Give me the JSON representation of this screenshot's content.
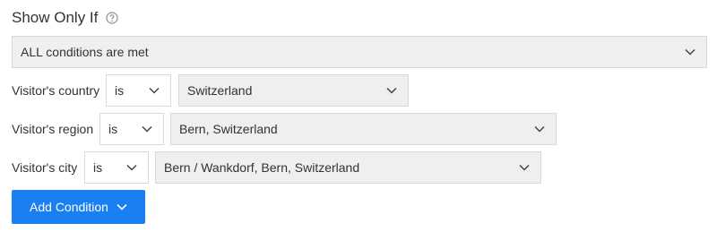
{
  "title": "Show Only If",
  "match_select": {
    "value": "ALL conditions are met"
  },
  "conditions": [
    {
      "label": "Visitor's country",
      "operator": "is",
      "value": "Switzerland"
    },
    {
      "label": "Visitor's region",
      "operator": "is",
      "value": "Bern, Switzerland"
    },
    {
      "label": "Visitor's city",
      "operator": "is",
      "value": "Bern / Wankdorf, Bern, Switzerland"
    }
  ],
  "add_button": {
    "label": "Add Condition"
  },
  "colors": {
    "accent": "#1a7ff0",
    "field_bg": "#eeeff1",
    "border": "#d7d9dc",
    "text": "#333333"
  },
  "icons": {
    "help": "question-circle-icon",
    "dropdown": "chevron-down-icon"
  }
}
